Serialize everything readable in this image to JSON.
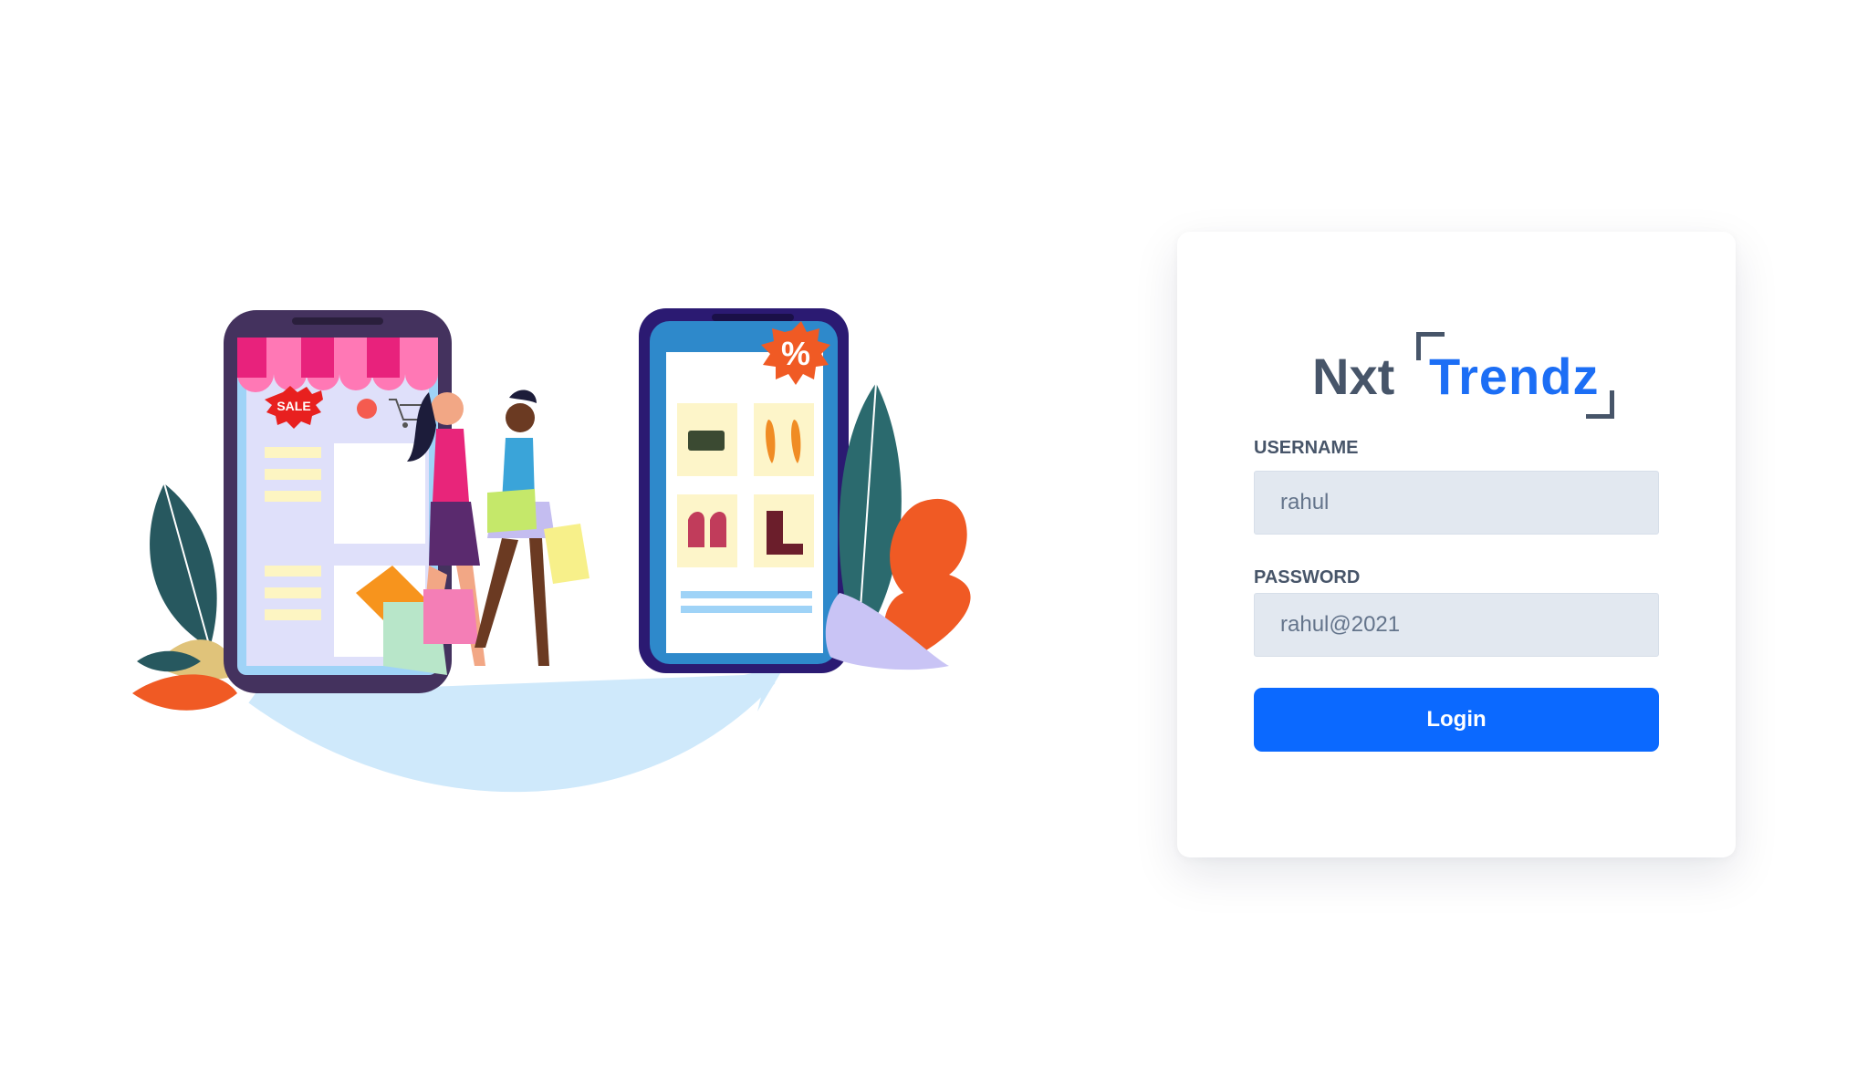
{
  "brand": {
    "name_part1": "Nxt",
    "name_part2": "Trendz"
  },
  "form": {
    "username": {
      "label": "USERNAME",
      "value": "rahul"
    },
    "password": {
      "label": "PASSWORD",
      "value": "rahul@2021"
    },
    "login_label": "Login"
  },
  "illustration": {
    "sale_badge": "SALE",
    "discount_badge": "%"
  },
  "colors": {
    "brand_blue": "#1c6ef5",
    "button_blue": "#0b69ff",
    "slate": "#475569",
    "input_bg": "#e2e8f0"
  }
}
